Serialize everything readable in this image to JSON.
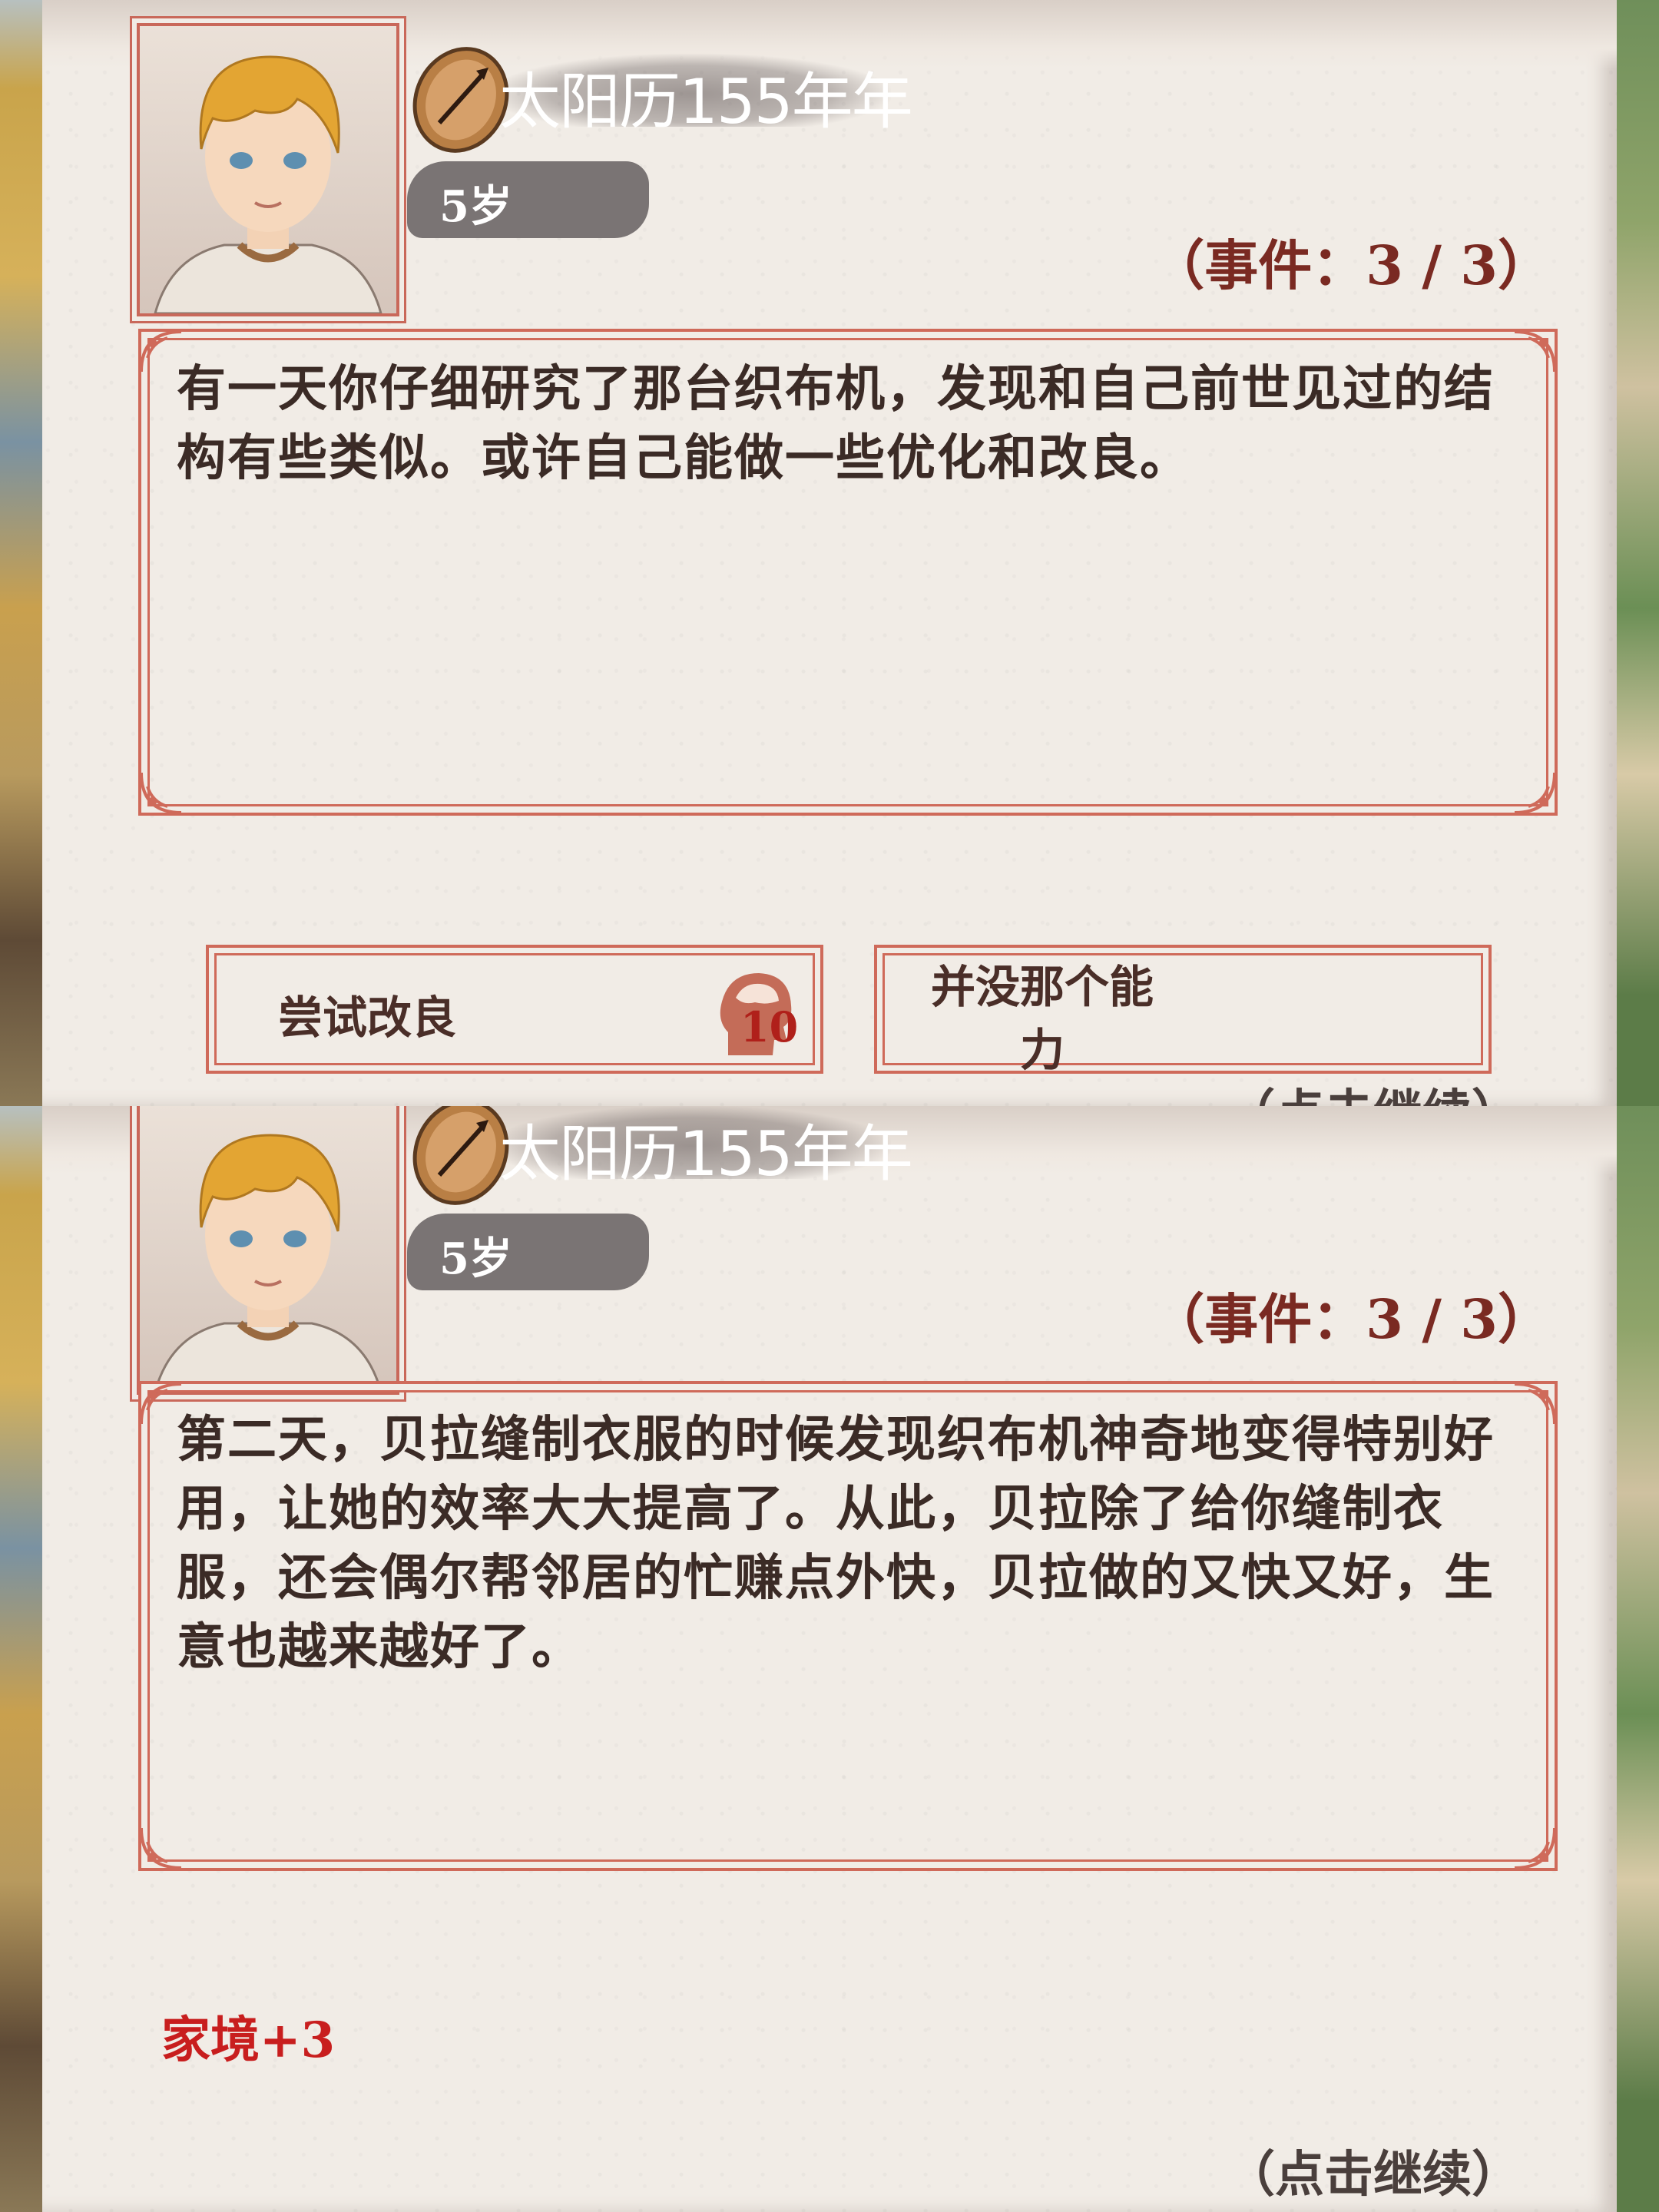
{
  "screens": [
    {
      "date": "太阳历155年年",
      "age": "5岁",
      "event_counter": "（事件：3 / 3）",
      "story": "有一天你仔细研究了那台织布机，发现和自己前世见过的结构有些类似。或许自己能做一些优化和改良。",
      "choices": [
        {
          "label": "尝试改良",
          "requirement_icon": "brain-head-icon",
          "requirement_value": "10"
        },
        {
          "label": "并没那个能力"
        }
      ],
      "continue_label": "（点击继续）"
    },
    {
      "date": "太阳历155年年",
      "age": "5岁",
      "event_counter": "（事件：3 / 3）",
      "story": "第二天，贝拉缝制衣服的时候发现织布机神奇地变得特别好用，让她的效率大大提高了。从此，贝拉除了给你缝制衣服，还会偶尔帮邻居的忙赚点外快，贝拉做的又快又好，生意也越来越好了。",
      "reward": "家境+3",
      "continue_label": "（点击继续）"
    }
  ],
  "colors": {
    "parchment": "#f1ece6",
    "frame": "#cf6a5a",
    "reward_red": "#c81e1e",
    "counter_text": "#7a2a22"
  }
}
